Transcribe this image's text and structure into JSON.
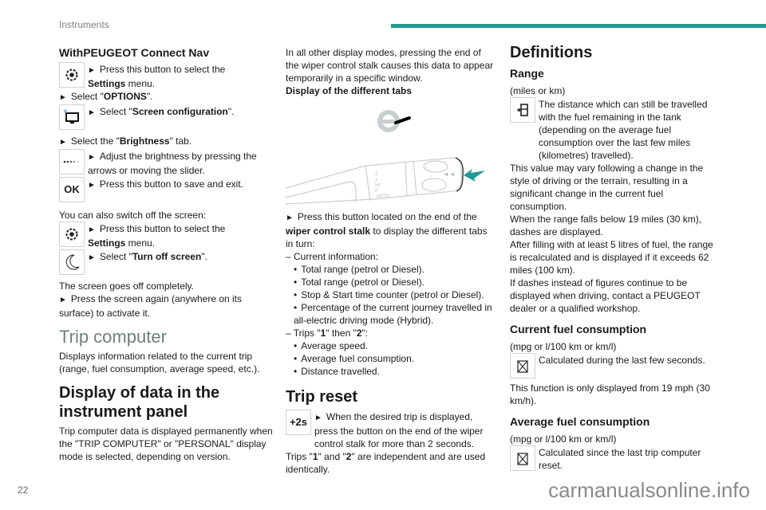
{
  "header": {
    "section_title": "Instruments",
    "accent_color": "#1f9a95"
  },
  "footer": {
    "page_number": "22",
    "watermark": "carmanualsonline.info"
  },
  "col1": {
    "heading": "WithPEUGEOT Connect Nav",
    "step1": "Press this button to select the",
    "step1_bold": "Settings",
    "step1_tail": " menu.",
    "step2_pre": "Select \"",
    "step2_bold": "OPTIONS",
    "step2_post": "\".",
    "step3_pre": "Select \"",
    "step3_bold": "Screen configuration",
    "step3_post": "\".",
    "step4_pre": "Select the \"",
    "step4_bold": "Brightness",
    "step4_post": "\" tab.",
    "step5": "Adjust the brightness by pressing the arrows or moving the slider.",
    "step6": "Press this button to save and exit.",
    "ok_label": "OK",
    "switch_off_intro": "You can also switch off the screen:",
    "step7": "Press this button to select the",
    "step7_bold": "Settings",
    "step7_tail": " menu.",
    "step8_pre": "Select \"",
    "step8_bold": "Turn off screen",
    "step8_post": "\".",
    "screen_off": "The screen goes off completely.",
    "reactivate": "Press the screen again (anywhere on its surface) to activate it.",
    "trip_heading": "Trip computer",
    "trip_desc": "Displays information related to the current trip (range, fuel consumption, average speed, etc.).",
    "display_heading": "Display of data in the instrument panel",
    "display_desc": "Trip computer data is displayed permanently when the \"TRIP COMPUTER\" or \"PERSONAL\" display mode is selected, depending on version."
  },
  "col2": {
    "intro": "In all other display modes, pressing the end of the wiper control stalk causes this data to appear temporarily in a specific window.",
    "tabs_heading": "Display of the different tabs",
    "stalk_labels": [
      "2",
      "1",
      "Int",
      "0",
      "AUTO"
    ],
    "press_pre": "Press this button located on the end of the ",
    "press_bold": "wiper control stalk",
    "press_post": " to display the different tabs in turn:",
    "current_info": "– Current information:",
    "current_items": [
      "Total range (petrol or Diesel).",
      "Total range (petrol or Diesel).",
      "Stop & Start time counter (petrol or Diesel).",
      "Percentage of the current journey travelled in all-electric driving mode (Hybrid)."
    ],
    "trips_pre": "– Trips \"",
    "trips_b1": "1",
    "trips_mid": "\" then \"",
    "trips_b2": "2",
    "trips_post": "\":",
    "trip_items": [
      "Average speed.",
      "Average fuel consumption.",
      "Distance travelled."
    ],
    "reset_heading": "Trip reset",
    "reset_icon_label": "+2s",
    "reset_text": "When the desired trip is displayed, press the button on the end of the wiper control stalk for more than 2 seconds.",
    "independent_pre": "Trips \"",
    "independent_b1": "1",
    "independent_mid": "\" and \"",
    "independent_b2": "2",
    "independent_post": "\" are independent and are used identically."
  },
  "col3": {
    "heading": "Definitions",
    "range_heading": "Range",
    "range_units": "(miles or km)",
    "range_text": "The distance which can still be travelled with the fuel remaining in the tank (depending on the average fuel consumption over the last few miles (kilometres) travelled).",
    "range_vary": "This value may vary following a change in the style of driving or the terrain, resulting in a significant change in the current fuel consumption.",
    "range_dashes": "When the range falls below 19 miles (30 km), dashes are displayed.",
    "range_refill": "After filling with at least 5 litres of fuel, the range is recalculated and is displayed if it exceeds 62 miles (100 km).",
    "range_contact": "If dashes instead of figures continue to be displayed when driving, contact a PEUGEOT dealer or a qualified workshop.",
    "current_heading": "Current fuel consumption",
    "current_units": "(mpg or l/100 km or km/l)",
    "current_text": "Calculated during the last few seconds.",
    "current_note": "This function is only displayed from 19 mph (30 km/h).",
    "average_heading": "Average fuel consumption",
    "average_units": "(mpg or l/100 km or km/l)",
    "average_text": "Calculated since the last trip computer reset."
  }
}
